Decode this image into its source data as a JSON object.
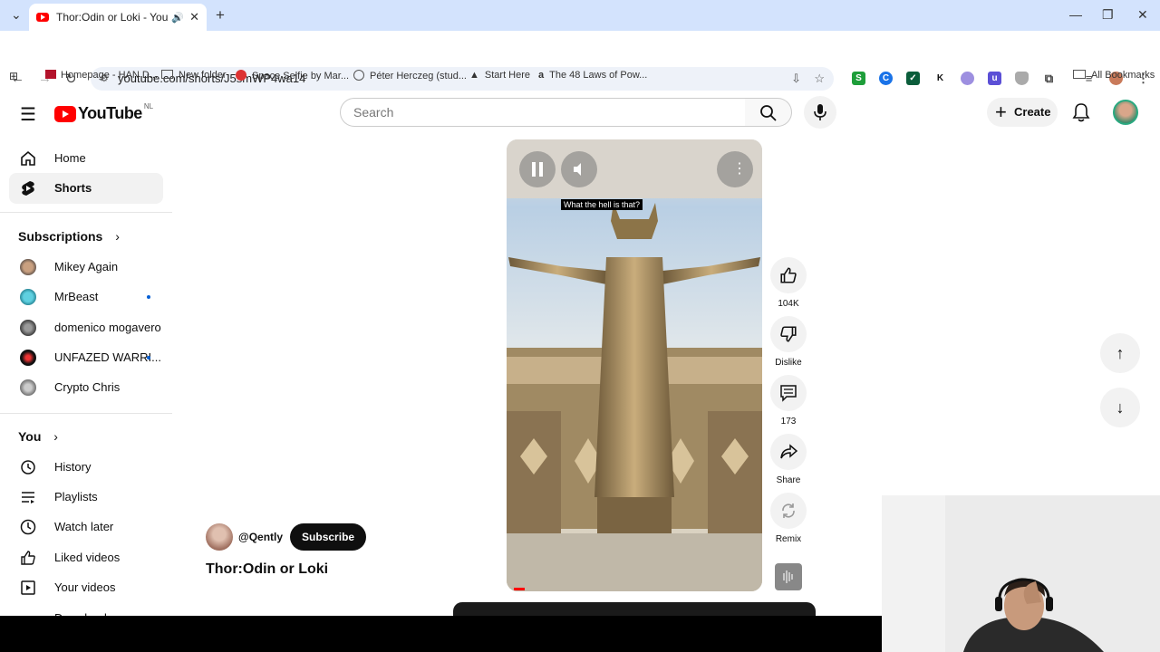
{
  "browser": {
    "tab_title": "Thor:Odin or Loki - YouTube",
    "url": "youtube.com/shorts/J5smWP4wa14",
    "bookmarks": [
      "Homepage - HAN D...",
      "New folder",
      "Space Selfie by Mar...",
      "Péter Herczeg (stud...",
      "Start Here",
      "The 48 Laws of Pow..."
    ],
    "all_bookmarks": "All Bookmarks"
  },
  "header": {
    "logo_text": "YouTube",
    "region": "NL",
    "search_placeholder": "Search",
    "create_label": "Create"
  },
  "sidebar": {
    "home": "Home",
    "shorts": "Shorts",
    "subscriptions_heading": "Subscriptions",
    "subscriptions": [
      {
        "name": "Mikey Again",
        "new": false
      },
      {
        "name": "MrBeast",
        "new": true
      },
      {
        "name": "domenico mogavero",
        "new": false
      },
      {
        "name": "UNFAZED WARRI...",
        "new": true
      },
      {
        "name": "Crypto Chris",
        "new": false
      }
    ],
    "you_heading": "You",
    "you_items": [
      "History",
      "Playlists",
      "Watch later",
      "Liked videos",
      "Your videos",
      "Downloads"
    ]
  },
  "short": {
    "caption": "What the hell is that?",
    "channel": "@Qently",
    "subscribe_label": "Subscribe",
    "title": "Thor:Odin or Loki",
    "likes": "104K",
    "dislike_label": "Dislike",
    "comments": "173",
    "share_label": "Share",
    "remix_label": "Remix"
  },
  "colors": {
    "brand_red": "#ff0000",
    "tab_strip": "#d3e3fd",
    "subscribe_bg": "#0f0f0f"
  }
}
